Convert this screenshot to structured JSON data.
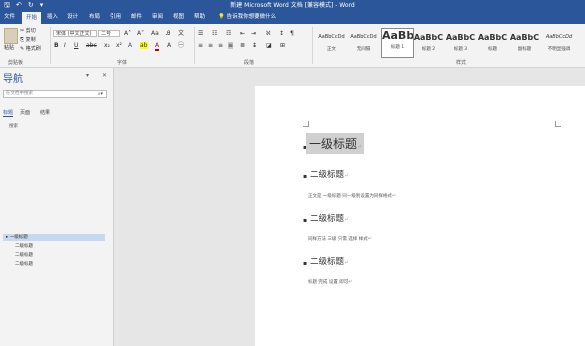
{
  "window": {
    "title": "新建 Microsoft Word 文档 [兼容模式] - Word"
  },
  "qat": {
    "save_icon": "save-icon",
    "undo_icon": "undo-icon",
    "redo_icon": "redo-icon",
    "customize_icon": "chevron-down-icon"
  },
  "tabs": [
    "文件",
    "开始",
    "插入",
    "设计",
    "布局",
    "引用",
    "邮件",
    "审阅",
    "视图",
    "帮助",
    "告诉我你想要做什么"
  ],
  "active_tab": "开始",
  "clipboard": {
    "paste": "粘贴",
    "cut": "剪切",
    "copy": "复制",
    "format_painter": "格式刷",
    "group": "剪贴板"
  },
  "font": {
    "name": "宋体 (中文正文)",
    "size": "二号",
    "bold": "B",
    "italic": "I",
    "underline": "U",
    "group": "字体"
  },
  "paragraph": {
    "group": "段落"
  },
  "styles": {
    "group": "样式",
    "items": [
      {
        "preview": "AaBbCcDd",
        "name": "正文"
      },
      {
        "preview": "AaBbCcDd",
        "name": "无间隔"
      },
      {
        "preview": "AaBb",
        "name": "标题 1"
      },
      {
        "preview": "AaBbC",
        "name": "标题 2"
      },
      {
        "preview": "AaBbC",
        "name": "标题 3"
      },
      {
        "preview": "AaBbC",
        "name": "标题"
      },
      {
        "preview": "AaBbC",
        "name": "副标题"
      },
      {
        "preview": "AaBbCcDd",
        "name": "不明显强调"
      }
    ]
  },
  "nav": {
    "title": "导航",
    "search_placeholder": "在文档中搜索",
    "tabs": [
      "标题",
      "页面",
      "结果"
    ],
    "hint": "搜索",
    "headings": [
      {
        "text": "▸ 一级标题",
        "selected": true
      },
      {
        "text": "二级标题",
        "selected": false
      },
      {
        "text": "二级标题",
        "selected": false
      },
      {
        "text": "二级标题",
        "selected": false
      }
    ]
  },
  "document": {
    "h1": "一级标题",
    "sections": [
      {
        "heading": "二级标题",
        "body": "正文是 一级标题 同一级别设置为同样格式"
      },
      {
        "heading": "二级标题",
        "body": "同样方法 三级 只需 选择 样式"
      },
      {
        "heading": "二级标题",
        "body": "标题 完成 设置 即可"
      }
    ]
  }
}
